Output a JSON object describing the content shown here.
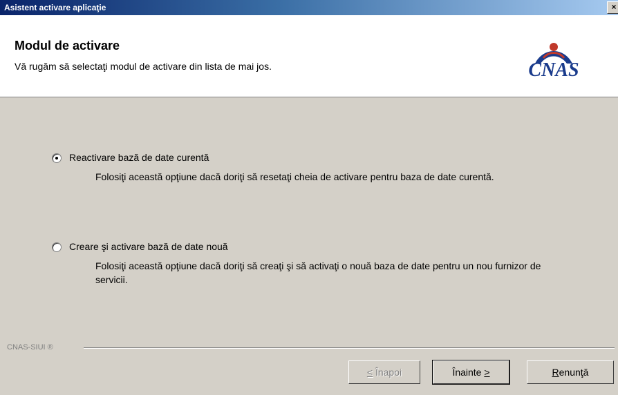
{
  "window": {
    "title": "Asistent activare aplicaţie",
    "close_label": "×"
  },
  "header": {
    "title": "Modul de activare",
    "subtitle": "Vă rugăm să selectaţi modul de activare din lista de mai jos.",
    "logo_text": "CNAS",
    "logo_color": "#1a3b8c",
    "logo_accent": "#c0392b"
  },
  "options": [
    {
      "label": "Reactivare bază de date curentă",
      "description": "Folosiţi această opţiune dacă doriţi să resetaţi cheia de activare pentru baza de date curentă.",
      "selected": true
    },
    {
      "label": "Creare şi activare bază de date nouă",
      "description": "Folosiţi această opţiune dacă doriţi să creaţi şi să activaţi o nouă baza de date pentru un nou furnizor de servicii.",
      "selected": false
    }
  ],
  "footer": {
    "brand": "CNAS-SIUI ®"
  },
  "buttons": {
    "back_mn": "<",
    "back_rest": " Înapoi",
    "next_pre": "Înainte ",
    "next_mn": ">",
    "cancel_mn": "R",
    "cancel_rest": "enunţă"
  }
}
